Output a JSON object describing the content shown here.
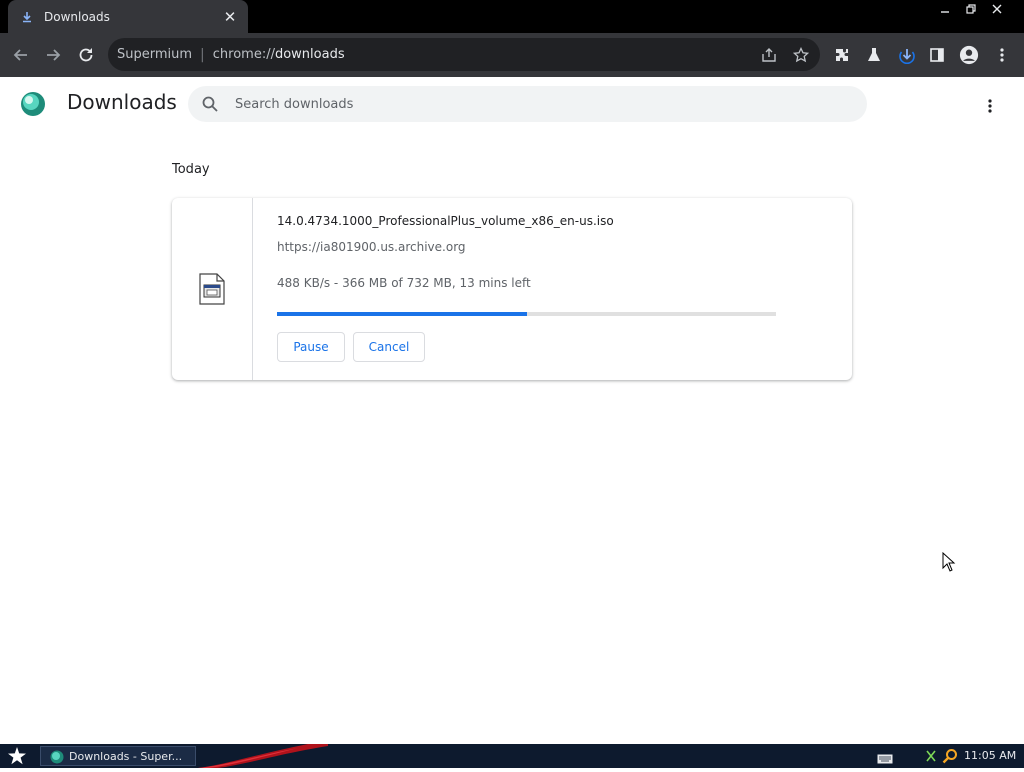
{
  "browser": {
    "tab": {
      "title": "Downloads"
    },
    "omnibox": {
      "site": "Supermium",
      "url_scheme": "chrome://",
      "url_host": "downloads"
    }
  },
  "page": {
    "title": "Downloads",
    "search": {
      "placeholder": "Search downloads"
    },
    "date_header": "Today",
    "download": {
      "file_name": "14.0.4734.1000_ProfessionalPlus_volume_x86_en-us.iso",
      "url": "https://ia801900.us.archive.org",
      "progress_text": "488 KB/s - 366 MB of 732 MB, 13 mins left",
      "progress_fraction": 0.5,
      "pause_label": "Pause",
      "cancel_label": "Cancel"
    }
  },
  "taskbar": {
    "task_item_label": "Downloads - Super...",
    "clock": "11:05 AM"
  },
  "colors": {
    "accent": "#1a73e8",
    "chrome_dark": "#35363a",
    "taskbar": "#0d1a2e"
  },
  "icons": [
    "download-icon",
    "close-icon",
    "minimize-icon",
    "restore-icon",
    "back-icon",
    "forward-icon",
    "reload-icon",
    "share-icon",
    "star-icon",
    "extensions-icon",
    "flask-icon",
    "download-indicator-icon",
    "side-panel-icon",
    "profile-icon",
    "kebab-menu-icon",
    "search-icon",
    "file-icon",
    "star-start-icon",
    "keyboard-icon",
    "network-icon",
    "magnifier-icon"
  ]
}
